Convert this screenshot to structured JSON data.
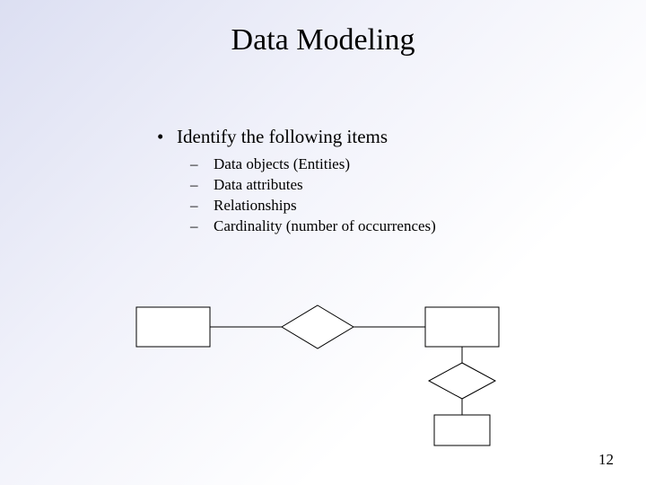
{
  "title": "Data Modeling",
  "main_bullet": {
    "marker": "•",
    "text": "Identify the following items"
  },
  "sub_bullets": {
    "marker": "–",
    "items": [
      "Data objects (Entities)",
      "Data attributes",
      "Relationships",
      "Cardinality (number of occurrences)"
    ]
  },
  "page_number": "12"
}
